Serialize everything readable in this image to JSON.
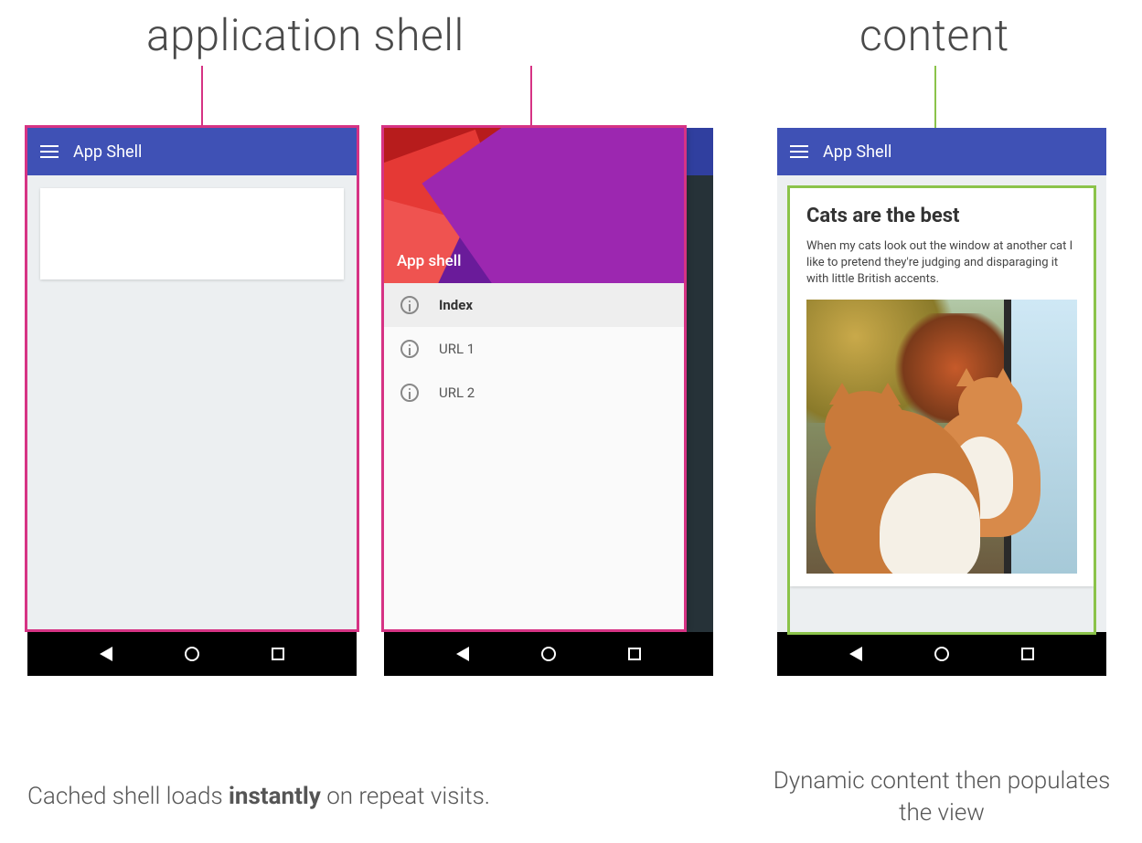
{
  "labels": {
    "app_shell": "application shell",
    "content": "content"
  },
  "phone_shell": {
    "appbar_title": "App Shell"
  },
  "drawer": {
    "header_title": "App shell",
    "items": [
      {
        "label": "Index",
        "selected": true
      },
      {
        "label": "URL 1",
        "selected": false
      },
      {
        "label": "URL 2",
        "selected": false
      }
    ]
  },
  "content_phone": {
    "appbar_title": "App Shell",
    "article_title": "Cats are the best",
    "article_body": "When my cats look out the window at another cat I like to pretend they're judging and disparaging it with little British accents."
  },
  "captions": {
    "left_pre": "Cached shell loads ",
    "left_strong": "instantly",
    "left_post": " on repeat visits.",
    "right": "Dynamic content then populates the view"
  },
  "colors": {
    "pink": "#d63384",
    "green": "#8bc34a",
    "appbar": "#3f51b5"
  }
}
